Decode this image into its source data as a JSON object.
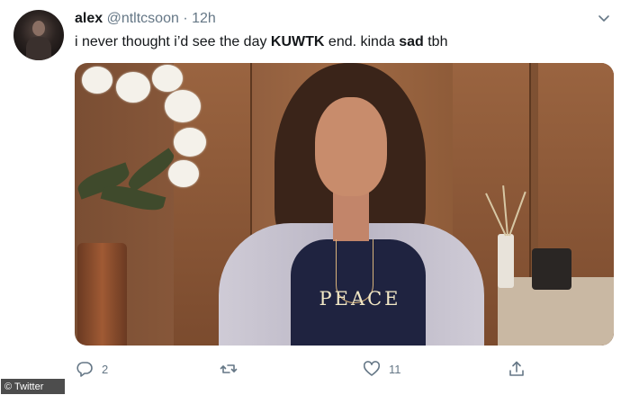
{
  "tweet": {
    "author_name": "alex",
    "handle": "@ntltcsoon",
    "separator": "·",
    "time": "12h",
    "text_parts": {
      "t1": "i never thought i’d see the day ",
      "t2": "KUWTK",
      "t3": " end. kinda ",
      "t4": "sad",
      "t5": " tbh"
    },
    "media": {
      "shirt_print": "PEACE"
    }
  },
  "actions": {
    "reply_count": "2",
    "retweet_count": "",
    "like_count": "11"
  },
  "watermark": "© Twitter",
  "icons": {
    "reply": "reply-icon",
    "retweet": "retweet-icon",
    "like": "heart-icon",
    "share": "share-icon",
    "menu": "chevron-down-icon"
  },
  "colors": {
    "text": "#14171a",
    "muted": "#657786",
    "background": "#ffffff"
  }
}
